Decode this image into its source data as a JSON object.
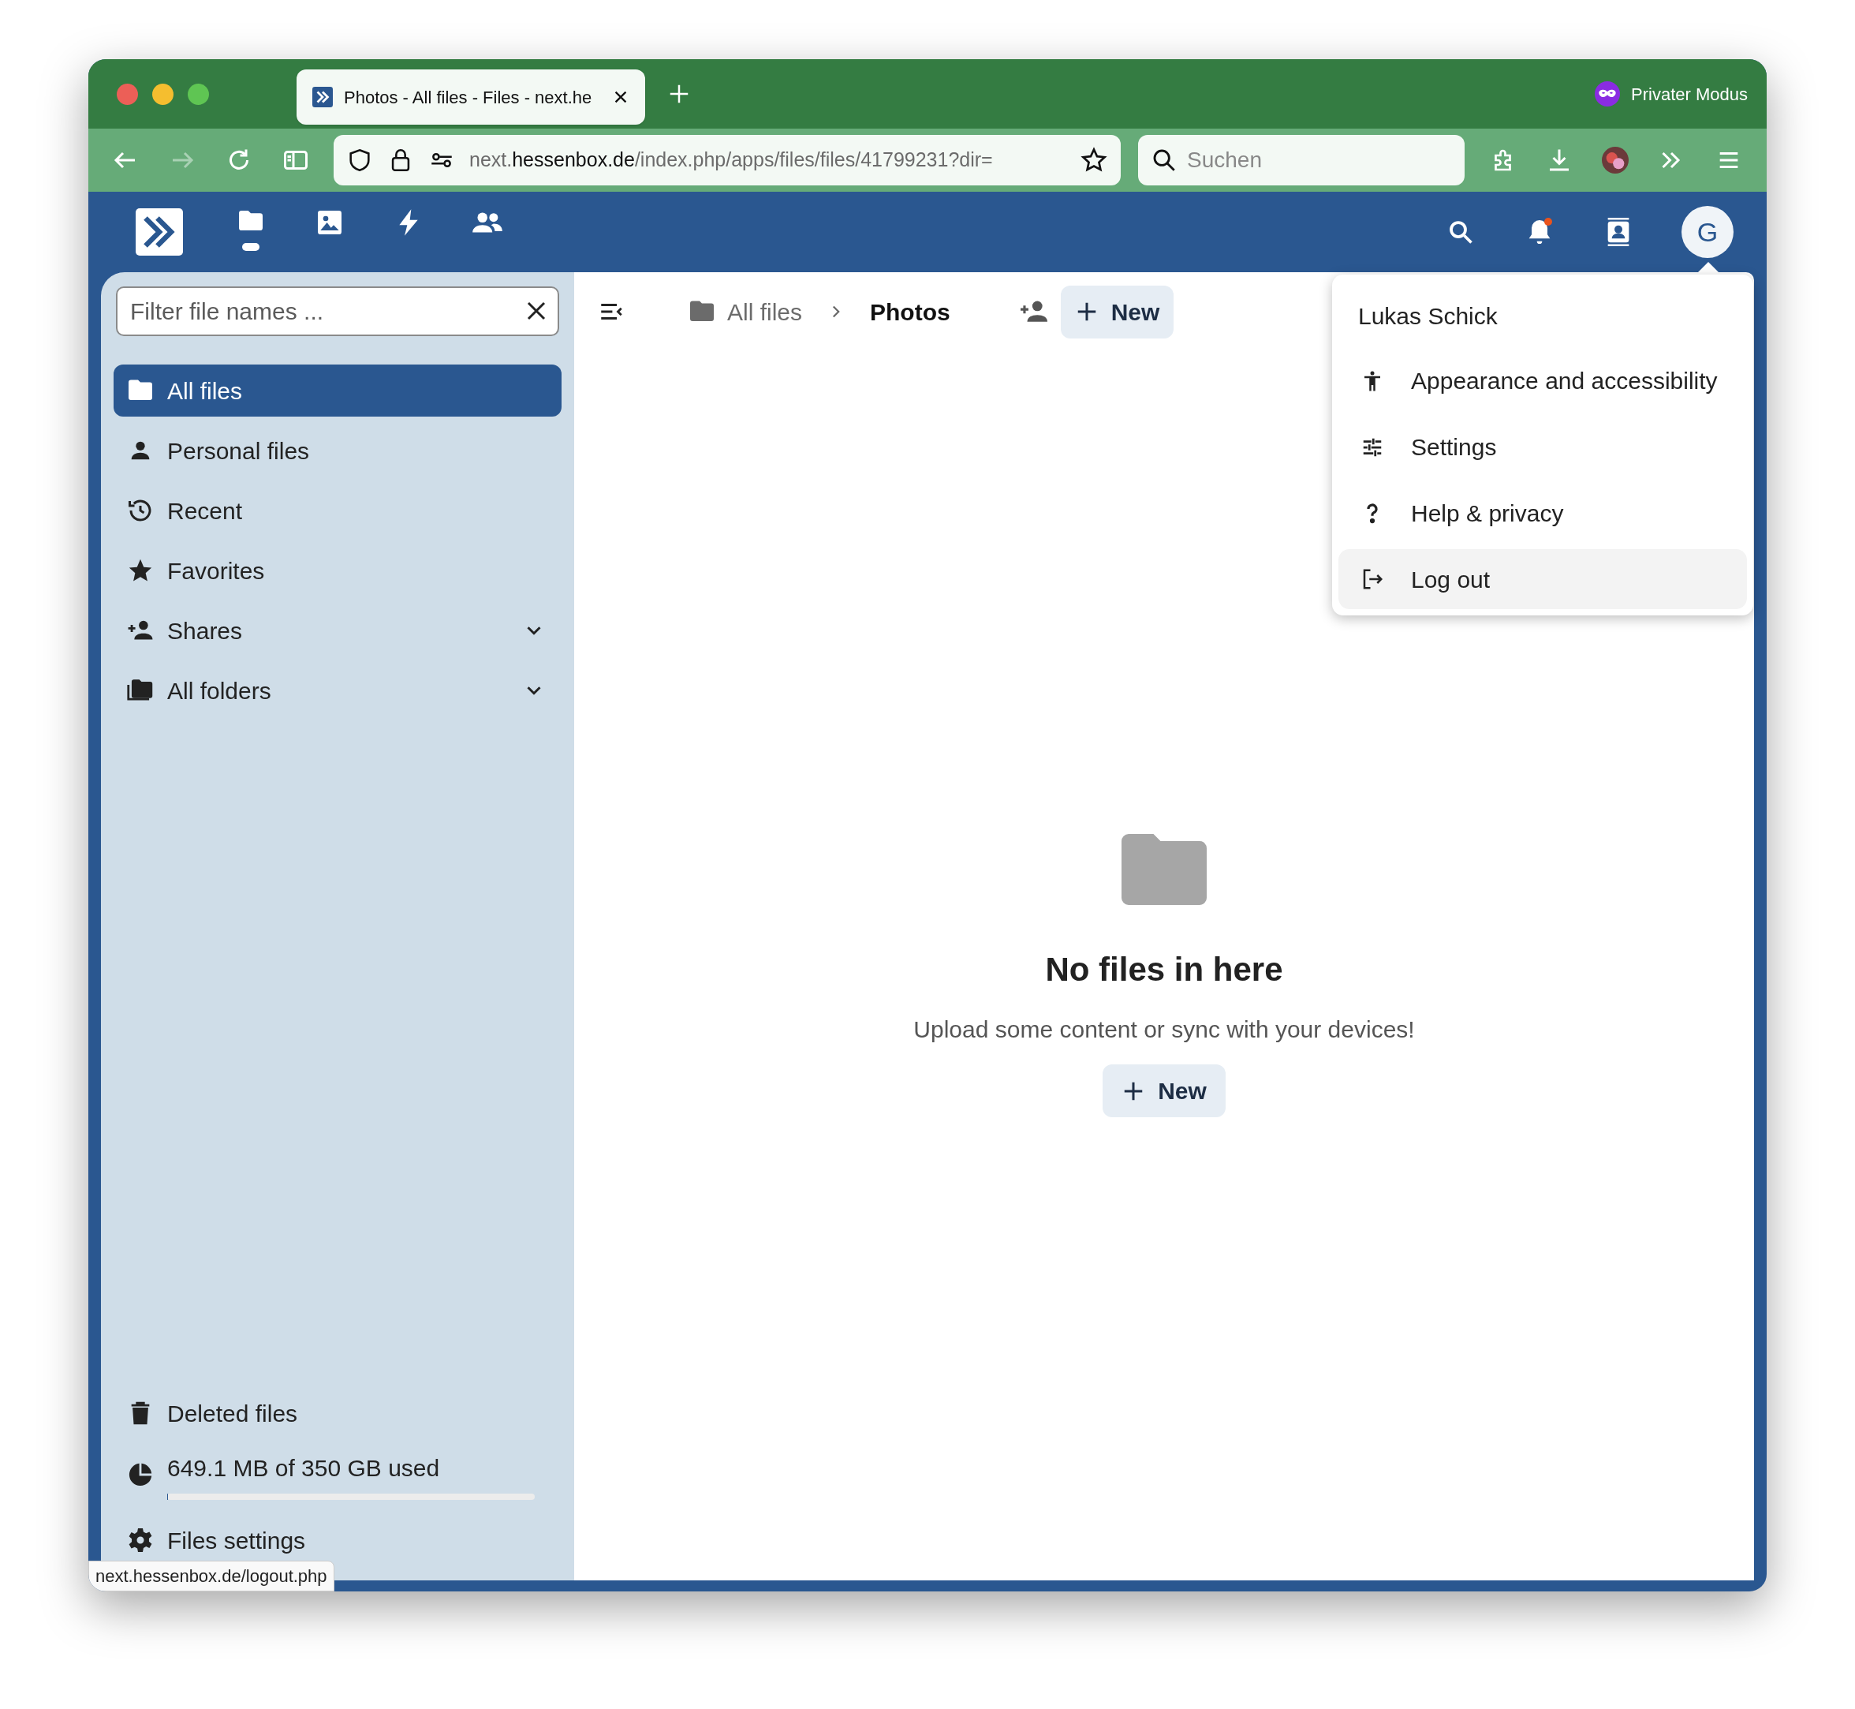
{
  "browser": {
    "tab": {
      "title": "Photos - All files - Files - next.he",
      "selected": true
    },
    "private_mode": "Privater Modus",
    "address": {
      "host_start": "next.",
      "host": "hessenbox.de",
      "path": "/index.php/apps/files/files/41799231?dir="
    },
    "search": {
      "placeholder": "Suchen"
    },
    "status_link": "next.hessenbox.de/logout.php"
  },
  "app_header": {
    "nav": [
      {
        "kind": "files",
        "selected": true
      },
      {
        "kind": "photos",
        "selected": false
      },
      {
        "kind": "activity",
        "selected": false
      },
      {
        "kind": "contacts",
        "selected": false
      }
    ],
    "notifications_unread": true,
    "avatar_letter": "G"
  },
  "sidebar": {
    "filter": {
      "placeholder": "Filter file names ..."
    },
    "items": [
      {
        "label": "All files",
        "kind": "folder",
        "selected": true,
        "expandable": false
      },
      {
        "label": "Personal files",
        "kind": "person",
        "selected": false,
        "expandable": false
      },
      {
        "label": "Recent",
        "kind": "history",
        "selected": false,
        "expandable": false
      },
      {
        "label": "Favorites",
        "kind": "star",
        "selected": false,
        "expandable": false
      },
      {
        "label": "Shares",
        "kind": "share",
        "selected": false,
        "expandable": true
      },
      {
        "label": "All folders",
        "kind": "folders",
        "selected": false,
        "expandable": true
      }
    ],
    "bottom": {
      "deleted": "Deleted files",
      "storage": {
        "text": "649.1 MB of 350 GB used",
        "level": 0.002
      },
      "settings": "Files settings"
    }
  },
  "breadcrumb": [
    "All files",
    "Photos"
  ],
  "new_button": "New",
  "empty_state": {
    "title": "No files in here",
    "text": "Upload some content or sync with your devices!",
    "button": "New"
  },
  "user_menu": {
    "name": "Lukas Schick",
    "items": [
      {
        "label": "Appearance and accessibility",
        "kind": "accessibility",
        "highlighted": false
      },
      {
        "label": "Settings",
        "kind": "sliders",
        "highlighted": false
      },
      {
        "label": "Help & privacy",
        "kind": "help",
        "highlighted": false
      },
      {
        "label": "Log out",
        "kind": "logout",
        "highlighted": true
      }
    ]
  }
}
